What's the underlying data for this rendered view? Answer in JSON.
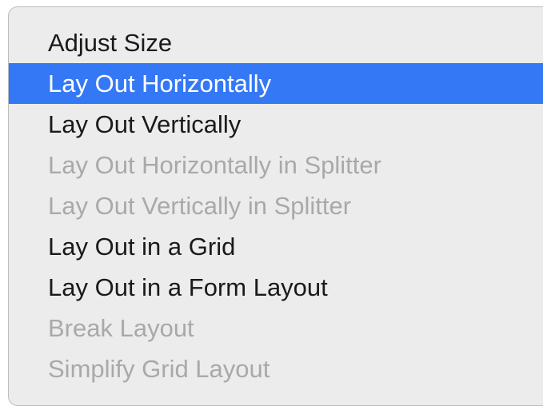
{
  "menu": {
    "items": [
      {
        "label": "Adjust Size",
        "state": "enabled"
      },
      {
        "label": "Lay Out Horizontally",
        "state": "highlighted"
      },
      {
        "label": "Lay Out Vertically",
        "state": "enabled"
      },
      {
        "label": "Lay Out Horizontally in Splitter",
        "state": "disabled"
      },
      {
        "label": "Lay Out Vertically in Splitter",
        "state": "disabled"
      },
      {
        "label": "Lay Out in a Grid",
        "state": "enabled"
      },
      {
        "label": "Lay Out in a Form Layout",
        "state": "enabled"
      },
      {
        "label": "Break Layout",
        "state": "disabled"
      },
      {
        "label": "Simplify Grid Layout",
        "state": "disabled"
      }
    ]
  },
  "colors": {
    "highlight": "#3478f6",
    "menu_background": "#ececec",
    "enabled_text": "#1a1a1a",
    "disabled_text": "#a9a9a9"
  }
}
